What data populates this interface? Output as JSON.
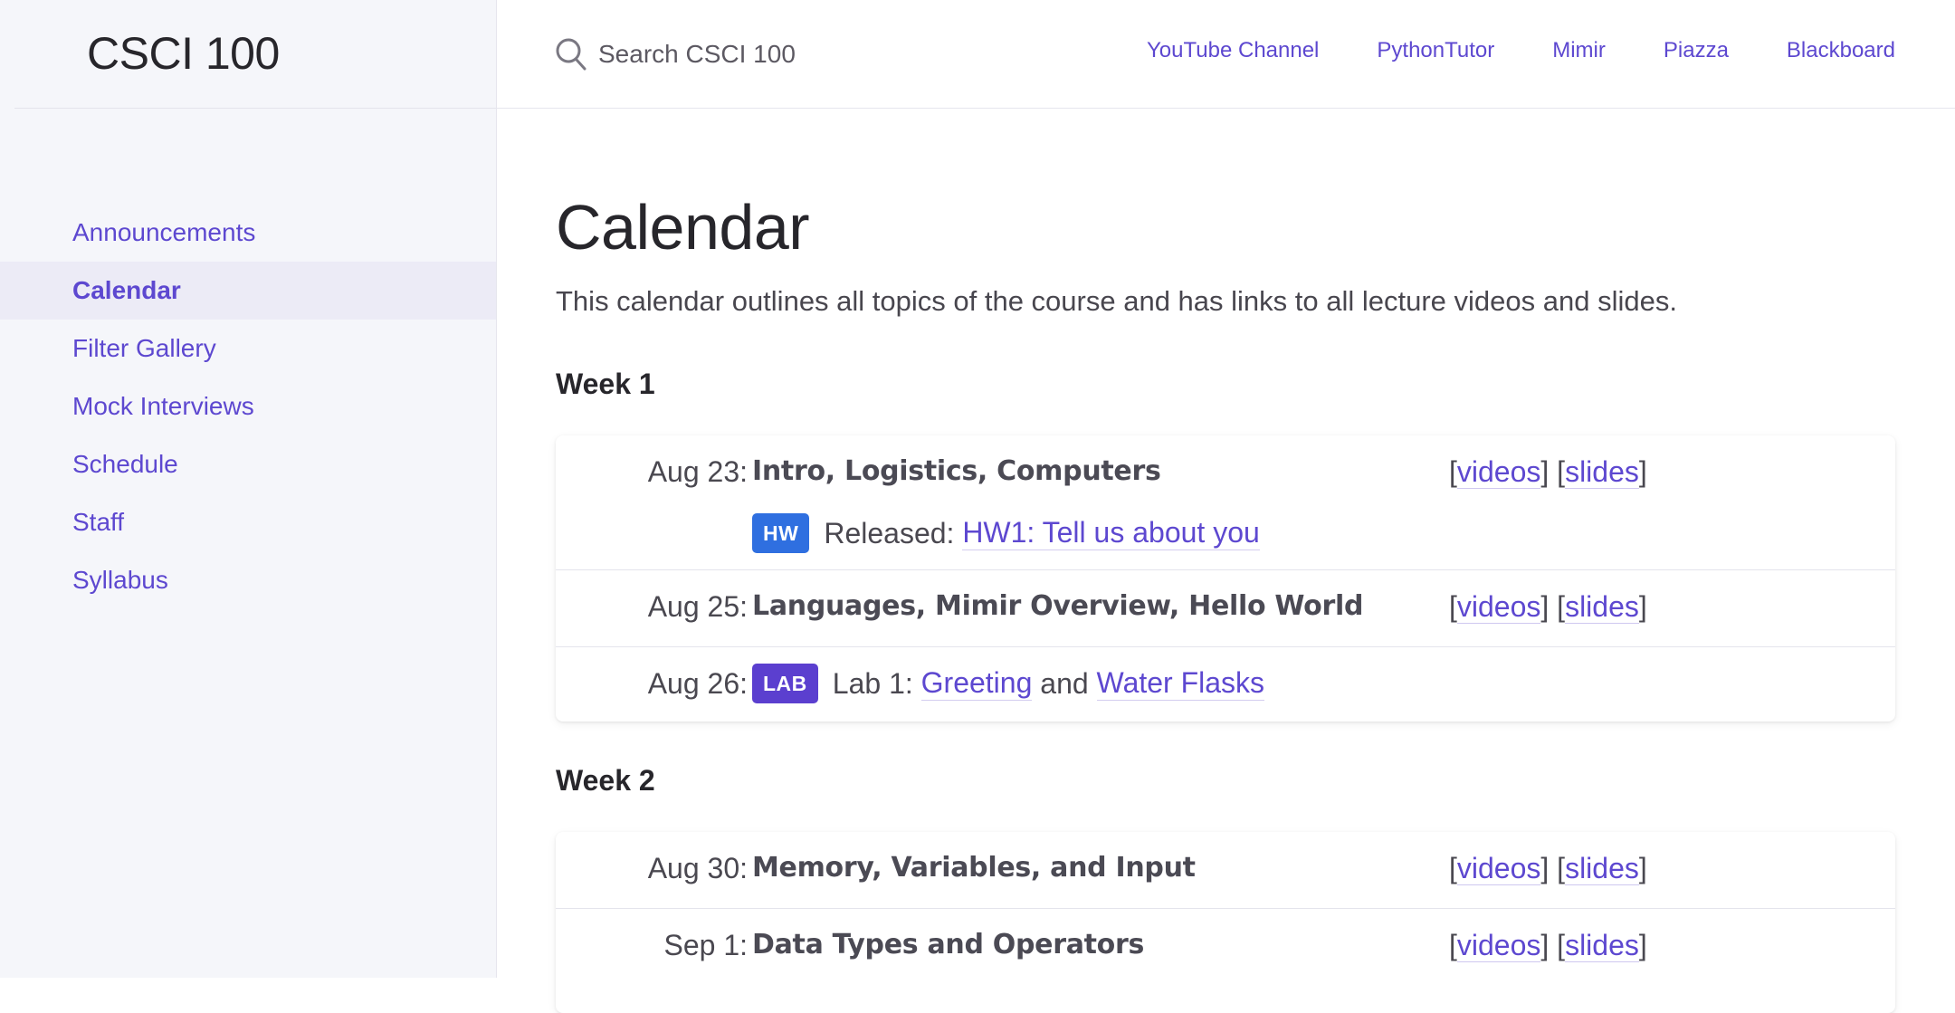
{
  "site": {
    "title": "CSCI 100"
  },
  "sidebar": {
    "items": [
      {
        "label": "Announcements",
        "active": false
      },
      {
        "label": "Calendar",
        "active": true
      },
      {
        "label": "Filter Gallery",
        "active": false
      },
      {
        "label": "Mock Interviews",
        "active": false
      },
      {
        "label": "Schedule",
        "active": false
      },
      {
        "label": "Staff",
        "active": false
      },
      {
        "label": "Syllabus",
        "active": false
      }
    ]
  },
  "header": {
    "search_placeholder": "Search CSCI 100",
    "links": [
      "YouTube Channel",
      "PythonTutor",
      "Mimir",
      "Piazza",
      "Blackboard"
    ]
  },
  "main": {
    "title": "Calendar",
    "description": "This calendar outlines all topics of the course and has links to all lecture videos and slides.",
    "weeks": [
      {
        "heading": "Week 1",
        "entries": [
          {
            "date": "Aug 23:",
            "topic": "Intro, Logistics, Computers",
            "videos": "videos",
            "slides": "slides",
            "sub": {
              "badge": "HW",
              "prefix": "Released:",
              "link": "HW1: Tell us about you"
            }
          },
          {
            "date": "Aug 25:",
            "topic": "Languages, Mimir Overview, Hello World",
            "videos": "videos",
            "slides": "slides"
          },
          {
            "date": "Aug 26:",
            "lab": {
              "badge": "LAB",
              "prefix": "Lab 1:",
              "link1": "Greeting",
              "joiner": "and",
              "link2": "Water Flasks"
            }
          }
        ]
      },
      {
        "heading": "Week 2",
        "entries": [
          {
            "date": "Aug 30:",
            "topic": "Memory, Variables, and Input",
            "videos": "videos",
            "slides": "slides"
          },
          {
            "date": "Sep 1:",
            "topic": "Data Types and Operators",
            "videos": "videos",
            "slides": "slides"
          }
        ]
      }
    ]
  },
  "colors": {
    "accent": "#5d48d0",
    "hw_badge": "#2f6fe0",
    "lab_badge": "#5b3fcf",
    "sidebar_bg": "#f5f6fa"
  }
}
